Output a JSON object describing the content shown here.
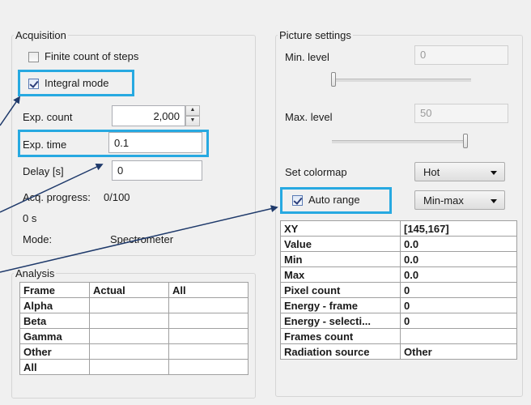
{
  "acquisition": {
    "title": "Acquisition",
    "finite_label": "Finite count of steps",
    "finite_checked": false,
    "integral_label": "Integral mode",
    "integral_checked": true,
    "exp_count_label": "Exp. count",
    "exp_count_value": "2,000",
    "exp_time_label": "Exp. time",
    "exp_time_value": "0.1",
    "delay_label": "Delay [s]",
    "delay_value": "0",
    "progress_label": "Acq. progress:",
    "progress_value": "0/100",
    "elapsed": "0 s",
    "mode_label": "Mode:",
    "mode_value": "Spectrometer"
  },
  "analysis": {
    "title": "Analysis",
    "columns": [
      "Frame",
      "Actual",
      "All"
    ],
    "rows": [
      "Alpha",
      "Beta",
      "Gamma",
      "Other",
      "All"
    ]
  },
  "picture": {
    "title": "Picture settings",
    "min_label": "Min. level",
    "min_value": "0",
    "max_label": "Max. level",
    "max_value": "50",
    "colormap_label": "Set colormap",
    "colormap_value": "Hot",
    "autorange_label": "Auto range",
    "autorange_checked": true,
    "range_mode_value": "Min-max",
    "stats": [
      {
        "key": "XY",
        "value": "[145,167]"
      },
      {
        "key": "Value",
        "value": "0.0"
      },
      {
        "key": "Min",
        "value": "0.0"
      },
      {
        "key": "Max",
        "value": "0.0"
      },
      {
        "key": "Pixel count",
        "value": "0"
      },
      {
        "key": "Energy - frame",
        "value": "0"
      },
      {
        "key": "Energy - selecti...",
        "value": "0"
      },
      {
        "key": "Frames count",
        "value": ""
      },
      {
        "key": "Radiation source",
        "value": "Other"
      }
    ]
  },
  "colors": {
    "highlight": "#27a9e1"
  }
}
